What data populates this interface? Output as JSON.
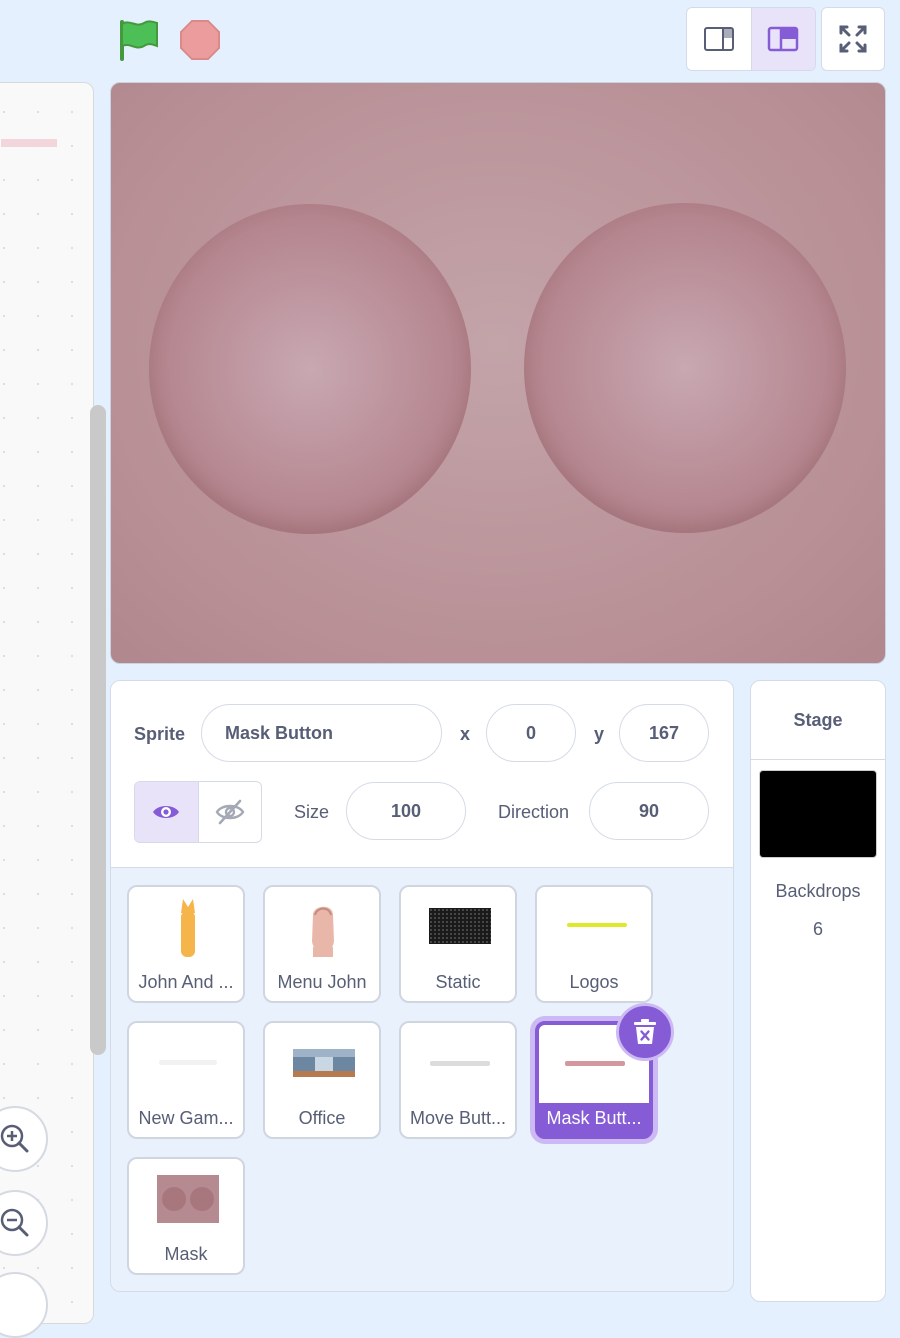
{
  "toolbar": {
    "green_flag_icon": "green-flag-icon",
    "stop_icon": "stop-icon",
    "small_stage_icon": "small-stage-icon",
    "normal_stage_icon": "normal-stage-icon",
    "fullscreen_icon": "fullscreen-icon"
  },
  "colors": {
    "accent": "#855cd6",
    "flag": "#4cbf56",
    "stop": "#ec9c9c",
    "text": "#575e75"
  },
  "sprite_info": {
    "sprite_label": "Sprite",
    "sprite_name": "Mask Button",
    "x_label": "x",
    "x_value": "0",
    "y_label": "y",
    "y_value": "167",
    "size_label": "Size",
    "size_value": "100",
    "direction_label": "Direction",
    "direction_value": "90",
    "visible": true
  },
  "sprites": [
    {
      "name": "John And ...",
      "selected": false
    },
    {
      "name": "Menu John",
      "selected": false
    },
    {
      "name": "Static",
      "selected": false
    },
    {
      "name": "Logos",
      "selected": false
    },
    {
      "name": "New Gam...",
      "selected": false
    },
    {
      "name": "Office",
      "selected": false
    },
    {
      "name": "Move Butt...",
      "selected": false
    },
    {
      "name": "Mask Butt...",
      "selected": true
    },
    {
      "name": "Mask",
      "selected": false
    }
  ],
  "stage_panel": {
    "title": "Stage",
    "backdrops_label": "Backdrops",
    "backdrops_count": "6"
  }
}
